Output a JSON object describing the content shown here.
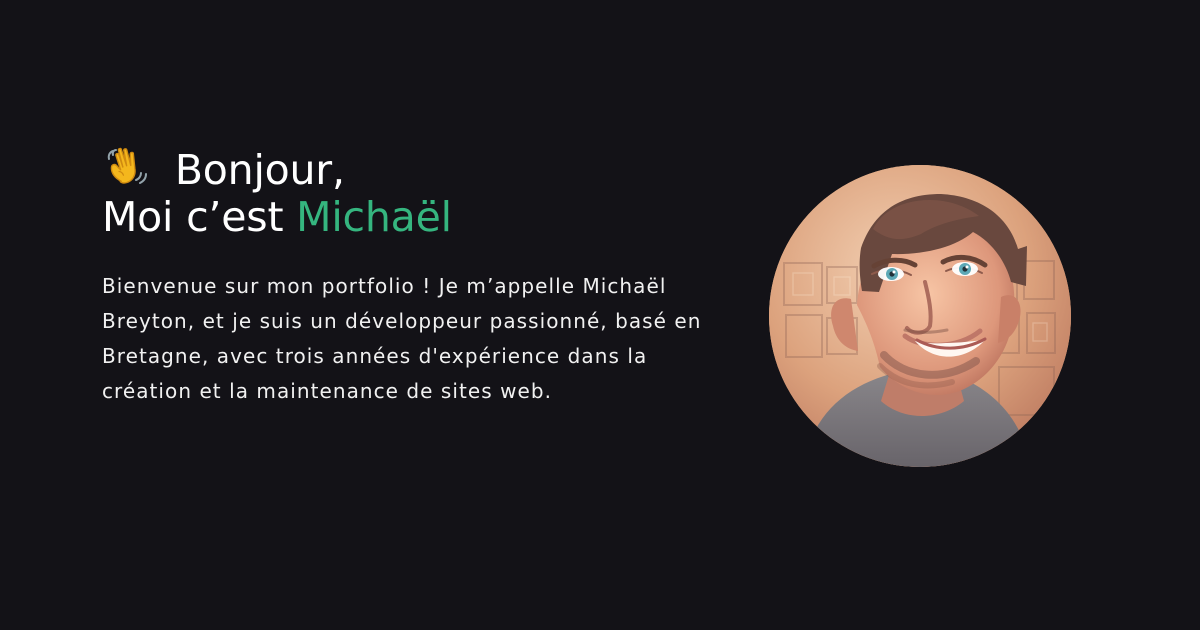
{
  "hero": {
    "greeting_word": "Bonjour,",
    "intro_prefix": "Moi c’est ",
    "name": "Michaël",
    "bio": "Bienvenue sur mon portfolio ! Je m’appelle Michaël Breyton, et je suis un développeur passionné, basé en Bretagne, avec trois années d'expérience dans la création et la maintenance de sites web."
  },
  "icons": {
    "greeting_icon": "waving-hand-icon"
  },
  "colors": {
    "background": "#131217",
    "text": "#ffffff",
    "accent": "#35b57f"
  }
}
